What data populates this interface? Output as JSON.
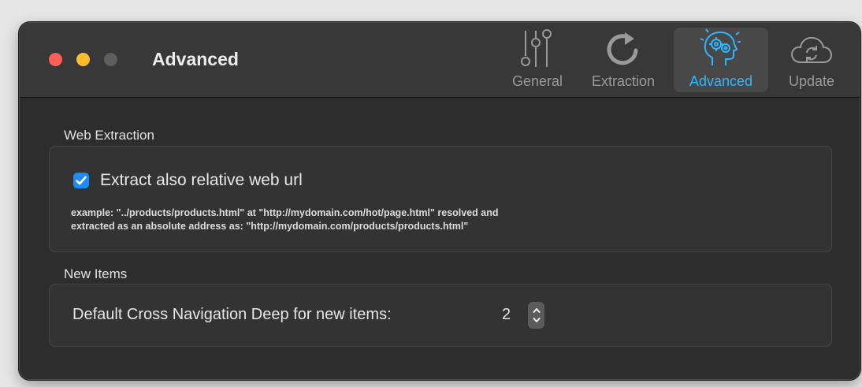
{
  "window": {
    "title": "Advanced"
  },
  "toolbar": {
    "tabs": [
      {
        "label": "General",
        "icon": "sliders-icon",
        "selected": false
      },
      {
        "label": "Extraction",
        "icon": "refresh-arrow-icon",
        "selected": false
      },
      {
        "label": "Advanced",
        "icon": "brain-gears-icon",
        "selected": true
      },
      {
        "label": "Update",
        "icon": "cloud-sync-icon",
        "selected": false
      }
    ]
  },
  "web_extraction": {
    "section_title": "Web Extraction",
    "checkbox_label": "Extract also relative web url",
    "checkbox_checked": true,
    "note_line1": "example: \"../products/products.html\" at \"http://mydomain.com/hot/page.html\" resolved and",
    "note_line2": "extracted as an absolute address as: \"http://mydomain.com/products/products.html\""
  },
  "new_items": {
    "section_title": "New Items",
    "label": "Default Cross Navigation Deep for new items:",
    "value": "2"
  },
  "colors": {
    "accent": "#2fb6ff",
    "checkbox": "#1d8df5",
    "close": "#fe5f57",
    "minimize": "#febc2e"
  }
}
